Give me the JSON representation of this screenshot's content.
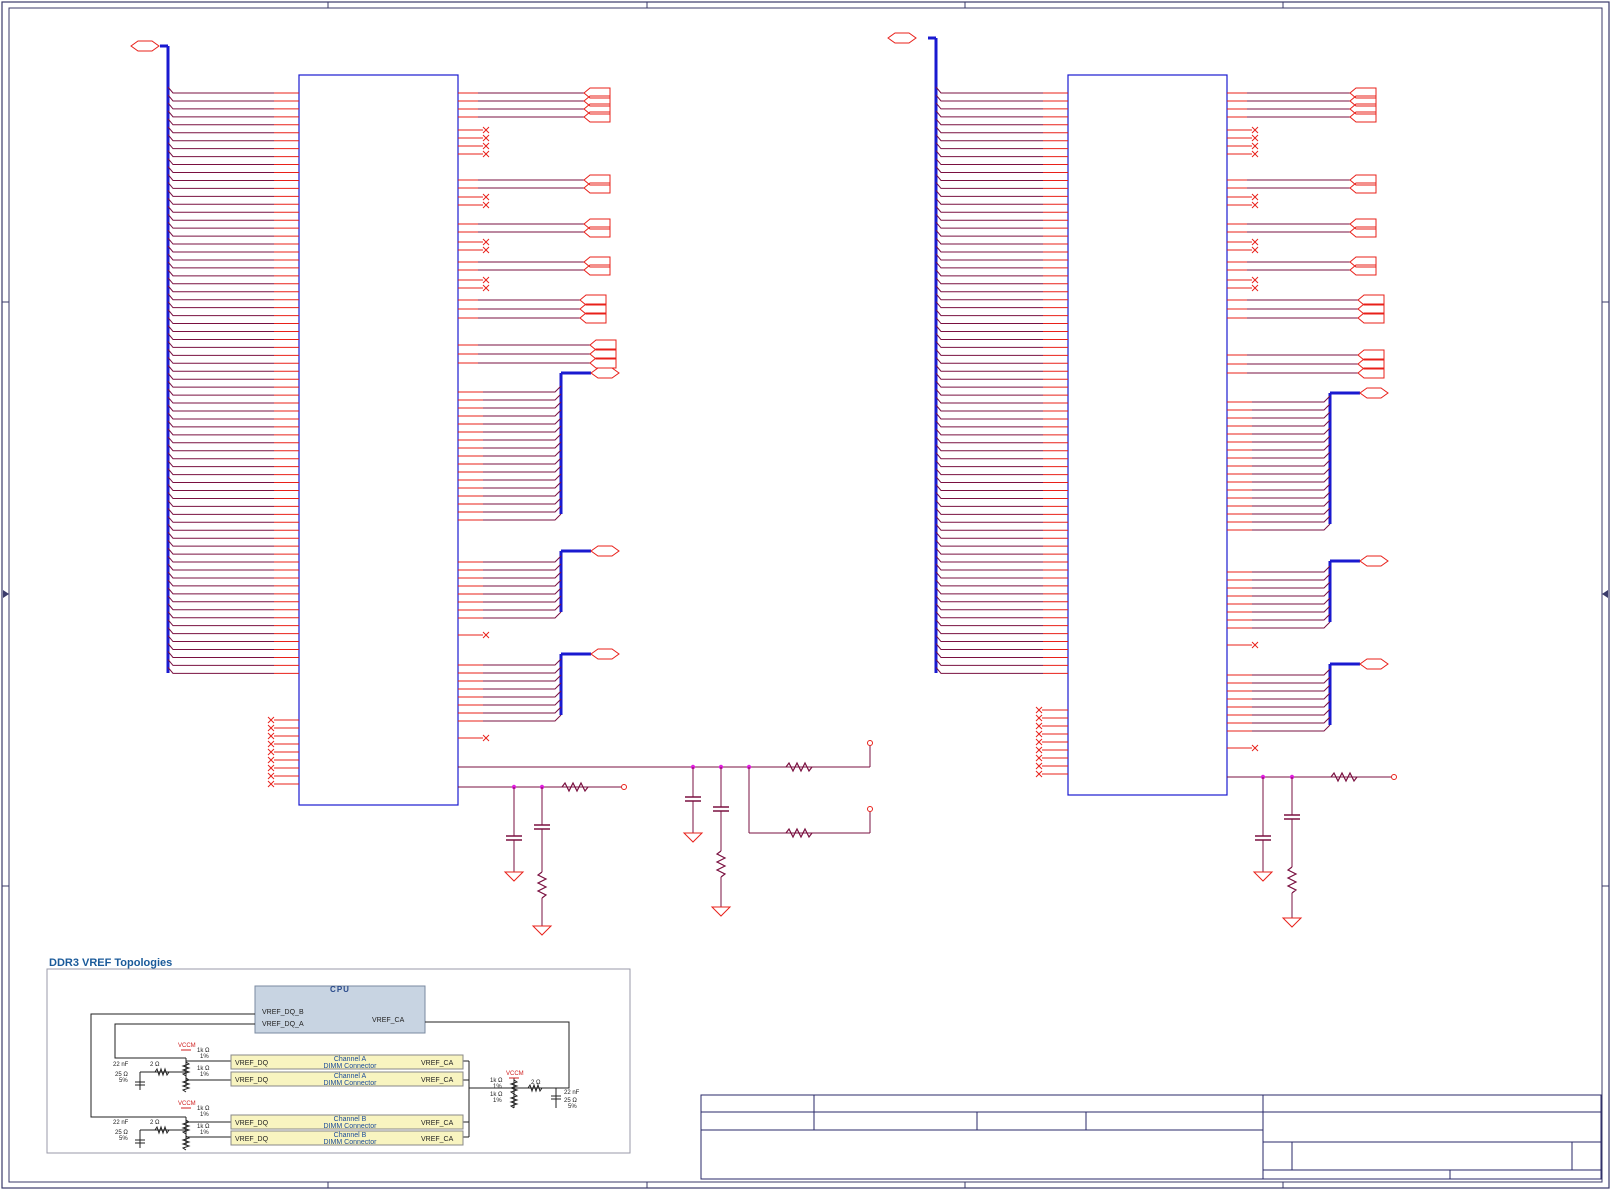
{
  "inset": {
    "title": "DDR3 VREF Topologies",
    "cpu": {
      "label": "CPU",
      "pin_dq_b": "VREF_DQ_B",
      "pin_dq_a": "VREF_DQ_A",
      "pin_ca": "VREF_CA"
    },
    "dimms": [
      {
        "pin_left": "VREF_DQ",
        "name": "Channel A",
        "sub": "DIMM Connector",
        "pin_right": "VREF_CA"
      },
      {
        "pin_left": "VREF_DQ",
        "name": "Channel A",
        "sub": "DIMM Connector",
        "pin_right": "VREF_CA"
      },
      {
        "pin_left": "VREF_DQ",
        "name": "Channel B",
        "sub": "DIMM Connector",
        "pin_right": "VREF_CA"
      },
      {
        "pin_left": "VREF_DQ",
        "name": "Channel B",
        "sub": "DIMM Connector",
        "pin_right": "VREF_CA"
      }
    ],
    "rail": "VCCM",
    "parts": {
      "r_top": "1k Ω",
      "r_top_tol": "1%",
      "r_bot": "1k Ω",
      "r_bot_tol": "1%",
      "r_series": "2 Ω",
      "cap": "22 nF",
      "r_term": "25 Ω",
      "r_term_tol": "5%"
    }
  },
  "colors": {
    "wire": "#e8201a",
    "net_wire": "#7a1040",
    "bus": "#1a1ad0",
    "junction": "#e020e0",
    "ground": "#e8201a",
    "title_block": "#2a2a6a"
  }
}
